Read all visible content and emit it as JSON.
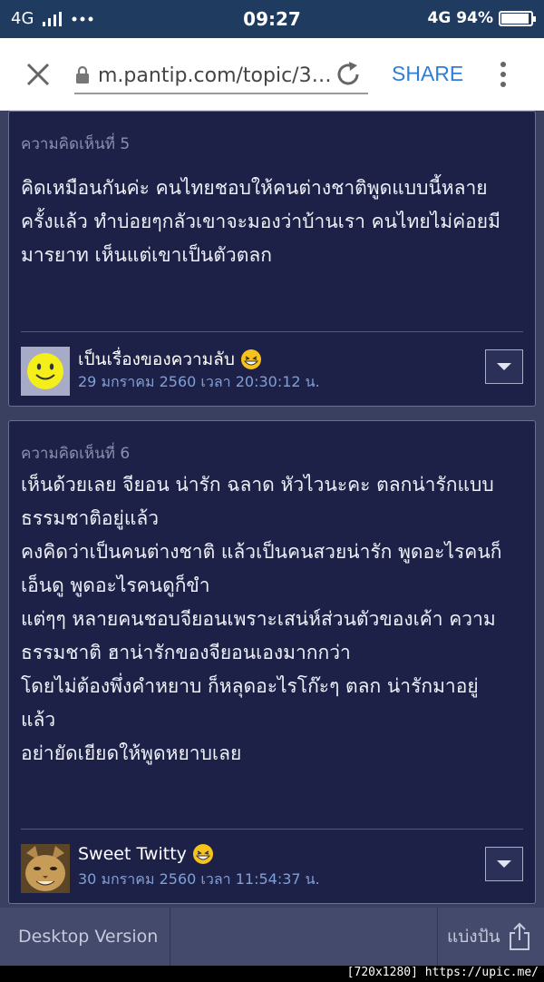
{
  "status_bar": {
    "network": "4G",
    "time": "09:27",
    "network_right": "4G",
    "battery": "94%",
    "battery_level": 0.94
  },
  "browser": {
    "url": "m.pantip.com/topic/3…",
    "share_label": "SHARE"
  },
  "comments": [
    {
      "number_label": "ความคิดเห็นที่ 5",
      "body": "คิดเหมือนกันค่ะ คนไทยชอบให้คนต่างชาติพูดแบบนี้หลาย\nครั้งแล้ว ทำบ่อยๆกลัวเขาจะมองว่าบ้านเรา คนไทยไม่ค่อยมี\nมารยาท เห็นแต่เขาเป็นตัวตลก",
      "author": "เป็นเรื่องของความลับ",
      "timestamp": "29 มกราคม 2560 เวลา 20:30:12 น.",
      "avatar_icon": "smiley-face-avatar"
    },
    {
      "number_label": "ความคิดเห็นที่ 6",
      "body": "เห็นด้วยเลย จียอน น่ารัก ฉลาด หัวไวนะคะ ตลกน่ารักแบบ\nธรรมชาติอยู่แล้ว\nคงคิดว่าเป็นคนต่างชาติ แล้วเป็นคนสวยน่ารัก พูดอะไรคนก็\nเอ็นดู พูดอะไรคนดูก็ขำ\nแต่ๆๆ หลายคนชอบจียอนเพราะเสน่ห์ส่วนตัวของเค้า ความ\nธรรมชาติ ฮาน่ารักของจียอนเองมากกว่า\nโดยไม่ต้องพึ่งคำหยาบ ก็หลุดอะไรโก๊ะๆ ตลก น่ารักมาอยู่\nแล้ว\nอย่ายัดเยียดให้พูดหยาบเลย",
      "author": "Sweet Twitty",
      "timestamp": "30 มกราคม 2560 เวลา 11:54:37 น.",
      "avatar_icon": "cat-avatar"
    }
  ],
  "bottom_bar": {
    "desktop_label": "Desktop Version",
    "share_label": "แบ่งปัน"
  },
  "watermark": "[720x1280] https://upic.me/",
  "colors": {
    "status_bar": "#1f3b60",
    "card_bg": "#1d2148",
    "page_bg": "#3a4160",
    "link_blue": "#2f7fd6",
    "timestamp": "#7fa0d6"
  }
}
